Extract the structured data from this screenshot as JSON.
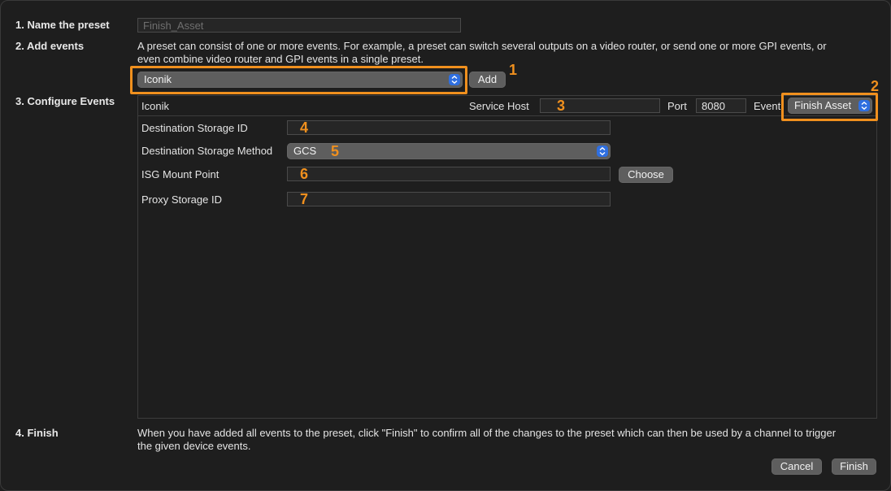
{
  "steps": {
    "name": "1. Name the preset",
    "add": "2. Add events",
    "configure": "3. Configure Events",
    "finish": "4. Finish"
  },
  "preset_name": {
    "value": "Finish_Asset"
  },
  "add_events": {
    "description_line1": "A preset can consist of one or more events. For example, a preset can switch several outputs on a video router, or send one or more GPI events, or",
    "description_line2": "even combine video router and GPI events in a single preset.",
    "device_select": "Iconik",
    "add_button": "Add"
  },
  "configure": {
    "device_name": "Iconik",
    "service_host_label": "Service Host",
    "service_host_value": "",
    "port_label": "Port",
    "port_value": "8080",
    "event_label": "Event",
    "event_select": "Finish Asset",
    "rows": [
      {
        "label": "Destination Storage ID",
        "value": ""
      },
      {
        "label": "Destination Storage Method",
        "value": "GCS"
      },
      {
        "label": "ISG Mount Point",
        "value": "",
        "button": "Choose"
      },
      {
        "label": "Proxy Storage ID",
        "value": ""
      }
    ]
  },
  "finish": {
    "description_line1": "When you have added all events to the preset, click \"Finish\" to confirm all of the changes to the preset which can then be used by a channel to trigger",
    "description_line2": "the given device events.",
    "cancel_button": "Cancel",
    "finish_button": "Finish"
  },
  "callouts": [
    "1",
    "2",
    "3",
    "4",
    "5",
    "6",
    "7"
  ],
  "colors": {
    "accent": "#f0901e",
    "stepper": "#2f6fe0",
    "background": "#1e1e1e"
  },
  "icons": {
    "stepper": "updown-chevron-icon"
  }
}
